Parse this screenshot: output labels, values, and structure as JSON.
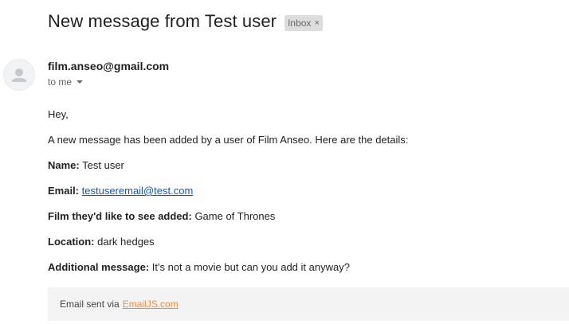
{
  "header": {
    "subject": "New message from Test user",
    "label": "Inbox",
    "label_remove": "×"
  },
  "message": {
    "sender": "film.anseo@gmail.com",
    "recipient": "to me",
    "greeting": "Hey,",
    "intro": "A new message has been added by a user of Film Anseo. Here are the details:",
    "fields": {
      "name_label": "Name:",
      "name_value": "Test user",
      "email_label": "Email:",
      "email_value": "testuseremail@test.com",
      "film_label": "Film they'd like to see added:",
      "film_value": "Game of Thrones",
      "location_label": "Location:",
      "location_value": "dark hedges",
      "additional_label": "Additional message:",
      "additional_value": "It's not a movie but can you add it anyway?"
    }
  },
  "footer": {
    "text": "Email sent via",
    "link_text": "EmailJS.com",
    "link_color": "#f28c3a"
  },
  "icons": {
    "avatar": "person-icon",
    "recipient_toggle": "chevron-down-icon",
    "label_remove": "close-icon"
  }
}
